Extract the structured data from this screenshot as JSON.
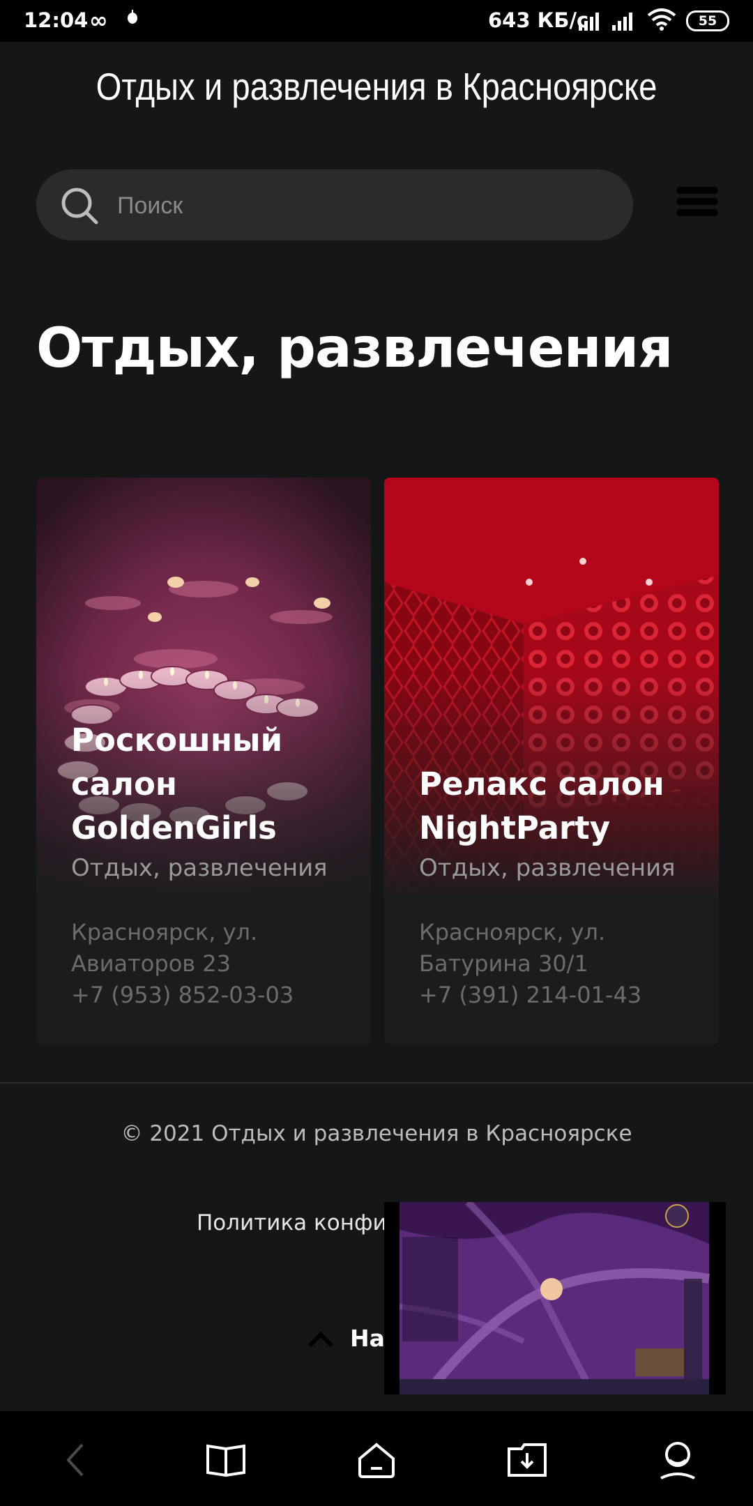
{
  "status_bar": {
    "time": "12:04",
    "net_speed": "643 КБ/с",
    "battery": "55"
  },
  "header": {
    "site_title": "Отдых и развлечения в Красноярске"
  },
  "search": {
    "placeholder": "Поиск"
  },
  "page": {
    "heading": "Отдых, развлечения"
  },
  "cards": [
    {
      "name_lines": [
        "Роскошный",
        "салон",
        "GoldenGirls"
      ],
      "category": "Отдых, развлечения",
      "address_line1": "Красноярск, ул.",
      "address_line2": "Авиаторов 23",
      "phone": "+7 (953) 852-03-03"
    },
    {
      "name_lines": [
        "Релакс салон",
        "NightParty"
      ],
      "category": "Отдых, развлечения",
      "address_line1": "Красноярск, ул.",
      "address_line2": "Батурина 30/1",
      "phone": "+7 (391) 214-01-43"
    }
  ],
  "footer": {
    "copyright": "© 2021 Отдых и развлечения в Красноярске",
    "policy_link": "Политика конфи",
    "to_top_label": "На"
  },
  "colors": {
    "background": "#151618",
    "card": "#1b1c1e",
    "search_bg": "#2a2b2d"
  },
  "nav_icons": [
    "back-icon",
    "bookmarks-icon",
    "home-icon",
    "downloads-icon",
    "profile-icon"
  ]
}
